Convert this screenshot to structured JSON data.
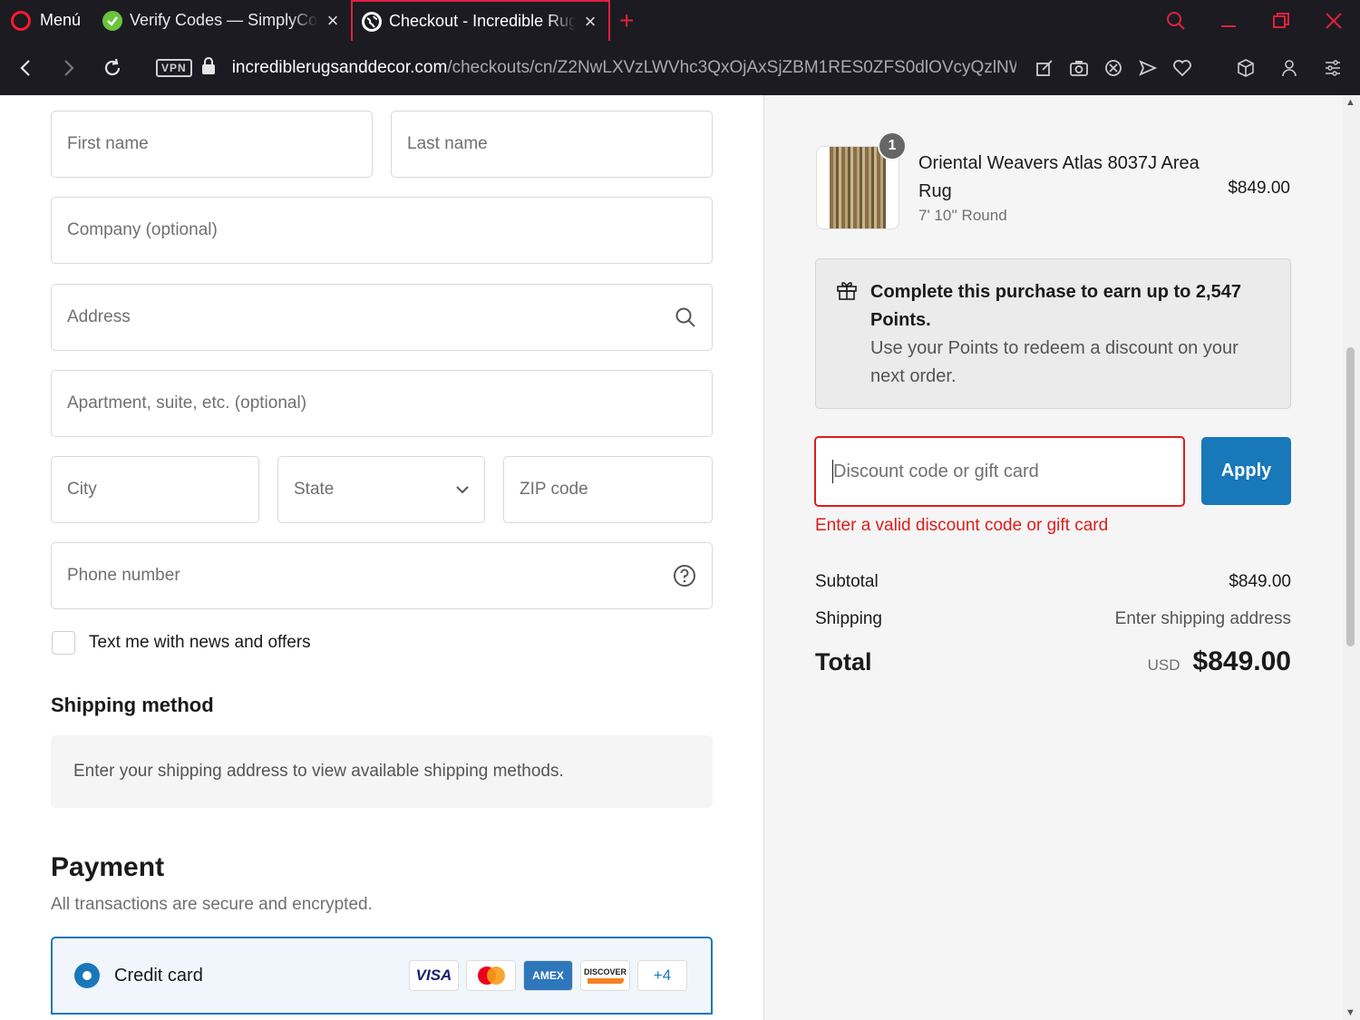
{
  "browser": {
    "menu_label": "Menú",
    "tabs": [
      {
        "title": "Verify Codes — SimplyCodes",
        "active": false
      },
      {
        "title": "Checkout - Incredible Rugs and Decor",
        "active": true
      }
    ],
    "vpn_label": "VPN",
    "url_host": "incrediblerugsanddecor.com",
    "url_path": "/checkouts/cn/Z2NwLXVzLWVhc3QxOjAxSjZBM1RES0ZFS0dlOVcyQzlNWU"
  },
  "form": {
    "first_name_placeholder": "First name",
    "last_name_placeholder": "Last name",
    "company_placeholder": "Company (optional)",
    "address_placeholder": "Address",
    "apartment_placeholder": "Apartment, suite, etc. (optional)",
    "city_placeholder": "City",
    "state_placeholder": "State",
    "zip_placeholder": "ZIP code",
    "phone_placeholder": "Phone number",
    "sms_optin_label": "Text me with news and offers"
  },
  "shipping": {
    "heading": "Shipping method",
    "message": "Enter your shipping address to view available shipping methods."
  },
  "payment": {
    "heading": "Payment",
    "subtitle": "All transactions are secure and encrypted.",
    "method_label": "Credit card",
    "cards": [
      "VISA",
      "Mastercard",
      "AMEX",
      "DISCOVER"
    ],
    "more_cards": "+4"
  },
  "summary": {
    "item": {
      "quantity": "1",
      "name": "Oriental Weavers Atlas 8037J Area Rug",
      "variant": "7' 10'' Round",
      "price": "$849.00"
    },
    "points": {
      "title": "Complete this purchase to earn up to 2,547 Points.",
      "subtitle": "Use your Points to redeem a discount on your next order."
    },
    "discount_placeholder": "Discount code or gift card",
    "apply_label": "Apply",
    "discount_error": "Enter a valid discount code or gift card",
    "subtotal_label": "Subtotal",
    "subtotal_value": "$849.00",
    "shipping_label": "Shipping",
    "shipping_value": "Enter shipping address",
    "total_label": "Total",
    "total_currency": "USD",
    "total_value": "$849.00"
  },
  "colors": {
    "accent": "#1878b9",
    "error": "#dd1d1d",
    "browser_bg": "#1c1b22",
    "browser_accent": "#e0213e"
  }
}
